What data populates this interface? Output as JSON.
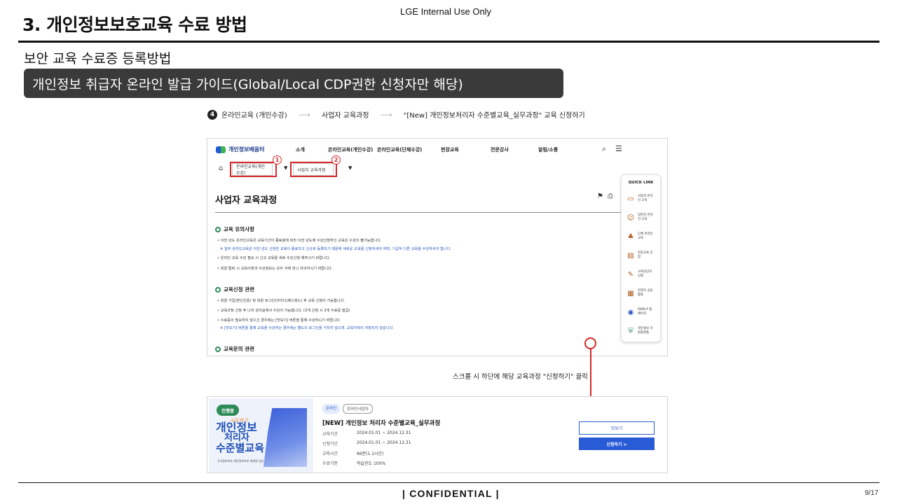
{
  "slide": {
    "title": "3. 개인정보보호교육 수료 방법",
    "internal_label": "LGE Internal Use Only",
    "subtitle": "보안 교육 수료증 등록방법",
    "guide": "개인정보 취급자 온라인 발급 가이드(Global/Local CDP권한 신청자만 해당)",
    "footer_label": "| CONFIDENTIAL |",
    "page": "9/17"
  },
  "steps": {
    "number": "4",
    "items": [
      "온라인교육 (개인수강)",
      "사업자 교육과정",
      "\"[New] 개인정보처리자 수준별교육_실무과정\" 교육 신청하기"
    ],
    "arrow": "⟶"
  },
  "site": {
    "logo": "개인정보배움터",
    "nav": [
      "소개",
      "온라인교육(개인수강)",
      "온라인교육(단체수강)",
      "현장교육",
      "전문강사",
      "알림/소통"
    ],
    "breadcrumb": {
      "first": "온라인교육(개인수강)",
      "second": "사업자 교육과정",
      "marker1": "1",
      "marker2": "2"
    },
    "page_title": "사업자 교육과정",
    "sections": [
      {
        "heading": "교육 유의사항",
        "bullets": [
          "• 이전 년도 온라인교육은 교육기간이 종료됨에 따라 이전 년도에 수강신청하신 교육은 수강이 불가능합니다.",
          "※ 일부 온라인교육은 이전 년도 신청한 교육이 종료되고 신규로 등록되기 때문에 새로운 교육을 신청하셔야 하며, 기급적 다른 교육을 수강하셔야 합니다.",
          "• 온라인 교육 수강 필요 시 신규 교육을 새로 수강신청 해주시기 바랍니다.",
          "• 회원 탈퇴 시 교육이력과 수강정보는 모두 삭제 되니 유의하시기 바랍니다."
        ]
      },
      {
        "heading": "교육신청 관련",
        "bullets": [
          "• 회원 가입(본인인증) 및 회원 로그인(아이디/패스워드) 후 교육 신청이 가능합니다.",
          "• 교육과정 신청 후 나의 강의실에서 수강이 가능합니다. (3개 신청 시 3개 수료증 발급)",
          "• 수료증이 필요하지 않으신 경우에는 [맛보기] 버튼을 통해 수강하시기 바랍니다.",
          "※ [맛보기] 버튼을 통해 교육을 수강하는 경우에는 별도의 로그인을 거치지 않으며, 교육이력이 저장되지 않습니다."
        ]
      },
      {
        "heading": "교육문의 관련",
        "bullets": []
      }
    ],
    "quick_link": {
      "title": "QUICK LINK",
      "items": [
        {
          "label": "사업자 온라인 교육",
          "icon": "monitor-icon"
        },
        {
          "label": "일반인 온라인 교육",
          "icon": "person-icon"
        },
        {
          "label": "단체 온라인 교육",
          "icon": "group-icon"
        },
        {
          "label": "현장교육 신청",
          "icon": "document-icon"
        },
        {
          "label": "교육담당자 신청",
          "icon": "pencil-icon"
        },
        {
          "label": "콘텐츠 공동활용",
          "icon": "folder-icon"
        },
        {
          "label": "ISMS-P 홈페이지",
          "icon": "isms-icon"
        },
        {
          "label": "개인정보 지원플랫폼",
          "icon": "shield-icon"
        }
      ]
    }
  },
  "scroll_note": "스크롤 시 하단에 해당 교육과정 \"신청하기\" 클릭",
  "course": {
    "status": "진행중",
    "thumb_lines": [
      "시도하기",
      "개인정보",
      "처리자",
      "수준별교육",
      "국가정보보호 개인정보보호 위원회 엄선"
    ],
    "tags": [
      "온라인",
      "온라인사업자"
    ],
    "title": "[NEW] 개인정보 처리자 수준별교육_실무과정",
    "info": [
      {
        "label": "교육기간",
        "value": "2024.01.01 ~ 2024.12.31"
      },
      {
        "label": "신청기간",
        "value": "2024.01.01 ~ 2024.12.31"
      },
      {
        "label": "교육시간",
        "value": "66분(1.1시간)"
      },
      {
        "label": "수료기준",
        "value": "학습진도 100%"
      }
    ],
    "preview_button": "맛보기",
    "apply_button": "신청하기 >"
  },
  "colors": {
    "accent": "#2a5bd7",
    "annotation": "#d62828",
    "status_green": "#2e8b57",
    "guide_bg": "#3a3a3a"
  }
}
